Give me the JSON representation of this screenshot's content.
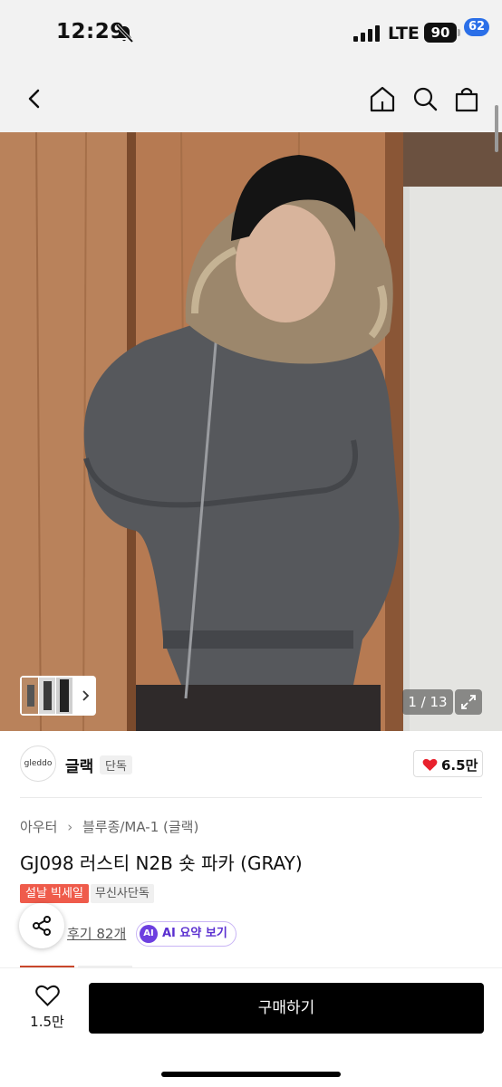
{
  "status_bar": {
    "time": "12:29",
    "network": "LTE",
    "battery": "90"
  },
  "nav": {
    "cart_count": "62"
  },
  "gallery": {
    "counter": "1 / 13"
  },
  "brand": {
    "logo_text": "gleddo",
    "name": "글랙",
    "tag": "단독",
    "likes": "6.5만"
  },
  "product": {
    "breadcrumb": [
      "아우터",
      "블루종/MA-1 (글랙)"
    ],
    "title": "GJ098 러스티 N2B 숏 파카 (GRAY)",
    "badge_sale": "설날 빅세일",
    "badge_exclusive": "무신사단독",
    "reviews": "후기 82개",
    "ai_badge": "AI",
    "ai_summary": "AI 요약 보기"
  },
  "bottom_bar": {
    "wish_count": "1.5만",
    "buy_label": "구매하기"
  },
  "colors": {
    "accent_blue": "#2b6fe8",
    "sale_red": "#ef5b4b",
    "ai_purple": "#6d3fe0",
    "heart_red": "#e8212d"
  }
}
